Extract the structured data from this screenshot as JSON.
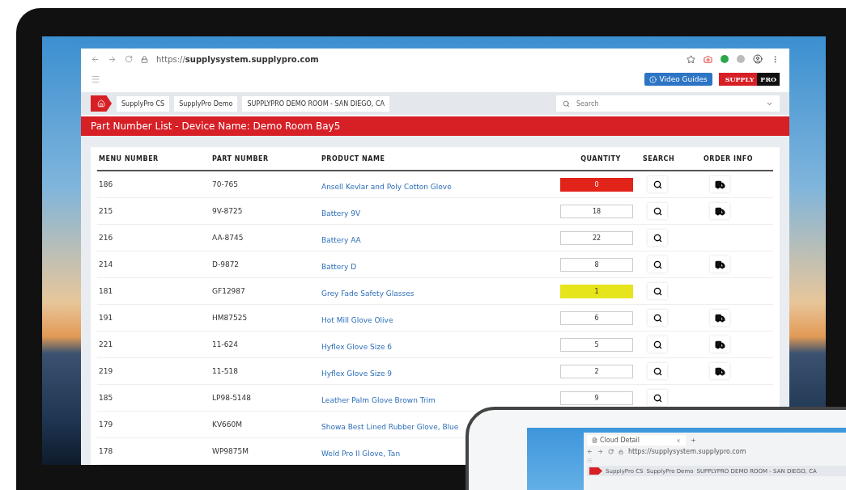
{
  "browser": {
    "url": "https://**supplysystem.supplypro.com**"
  },
  "header": {
    "video_guides": "Video Guides",
    "logo": [
      "SUPPLY",
      "PRO"
    ]
  },
  "breadcrumbs": [
    "SupplyPro CS",
    "SupplyPro Demo",
    "SUPPLYPRO DEMO ROOM - SAN DIEGO, CA"
  ],
  "search": {
    "placeholder": "Search"
  },
  "title": "Part Number List - Device Name: Demo Room Bay5",
  "table": {
    "columns": [
      "MENU NUMBER",
      "PART NUMBER",
      "PRODUCT NAME",
      "QUANTITY",
      "SEARCH",
      "ORDER INFO"
    ],
    "rows": [
      {
        "menu": "186",
        "part": "70-765",
        "product": "Ansell Kevlar and Poly Cotton Glove",
        "quantity": "0",
        "color": "#e2231a",
        "order_info": true
      },
      {
        "menu": "215",
        "part": "9V-8725",
        "product": "Battery 9V",
        "quantity": "18",
        "order_info": true
      },
      {
        "menu": "216",
        "part": "AA-8745",
        "product": "Battery AA",
        "quantity": "22",
        "order_info": false
      },
      {
        "menu": "214",
        "part": "D-9872",
        "product": "Battery D",
        "quantity": "8",
        "order_info": true
      },
      {
        "menu": "181",
        "part": "GF12987",
        "product": "Grey Fade Safety Glasses",
        "quantity": "1",
        "color": "#e6e41a",
        "order_info": false
      },
      {
        "menu": "191",
        "part": "HM87525",
        "product": "Hot Mill Glove Olive",
        "quantity": "6",
        "order_info": true
      },
      {
        "menu": "221",
        "part": "11-624",
        "product": "Hyflex Glove Size 6",
        "quantity": "5",
        "order_info": true
      },
      {
        "menu": "219",
        "part": "11-518",
        "product": "Hyflex Glove Size 9",
        "quantity": "2",
        "order_info": true
      },
      {
        "menu": "185",
        "part": "LP98-5148",
        "product": "Leather Palm Glove Brown Trim",
        "quantity": "9",
        "order_info": false
      },
      {
        "menu": "179",
        "part": "KV660M",
        "product": "Showa Best Lined Rubber Glove, Blue"
      },
      {
        "menu": "178",
        "part": "WP9875M",
        "product": "Weld Pro II Glove, Tan"
      }
    ]
  },
  "laptop": {
    "tab": "Cloud Detail",
    "url": "https://supplysystem.supplypro.com",
    "breadcrumbs": [
      "SupplyPro CS",
      "SupplyPro Demo",
      "SUPPLYPRO DEMO ROOM - SAN DIEGO, CA"
    ]
  }
}
